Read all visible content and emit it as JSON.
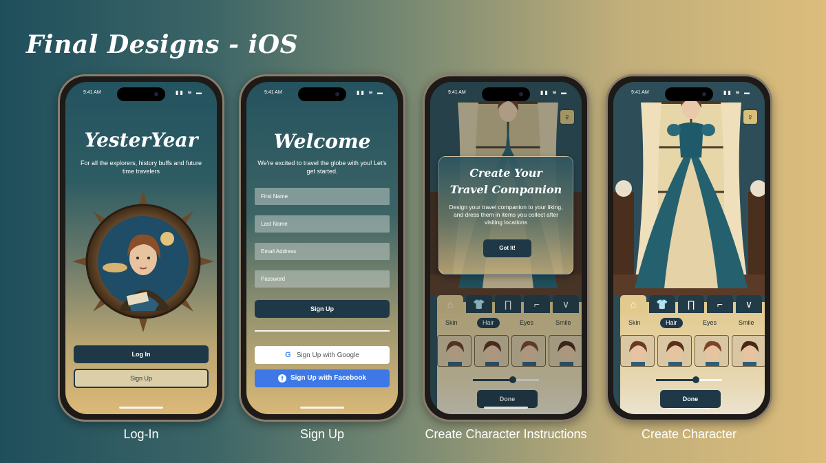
{
  "slide": {
    "title": "Final Designs - iOS"
  },
  "status_bar": {
    "time": "9:41 AM"
  },
  "login": {
    "caption": "Log-In",
    "app_title": "YesterYear",
    "subtitle": "For all the explorers, history buffs and future time travelers",
    "login_button": "Log In",
    "signup_button": "Sign Up"
  },
  "signup": {
    "caption": "Sign Up",
    "title": "Welcome",
    "subtitle": "We're excited to travel the globe with you! Let's get started.",
    "fields": [
      {
        "placeholder": "First Name"
      },
      {
        "placeholder": "Last Name"
      },
      {
        "placeholder": "Email Address"
      },
      {
        "placeholder": "Password"
      }
    ],
    "signup_button": "Sign Up",
    "google_button": "Sign Up with Google",
    "facebook_button": "Sign Up with Facebook"
  },
  "instructions": {
    "caption": "Create Character Instructions",
    "modal_title_line1": "Create Your",
    "modal_title_line2": "Travel Companion",
    "modal_text": "Design your travel companion to your liking, and dress them in items you collect after visiting locations",
    "got_it_button": "Got It!"
  },
  "character": {
    "caption": "Create Character",
    "subtabs": [
      "Skin",
      "Hair",
      "Eyes",
      "Smile"
    ],
    "active_subtab": "Hair",
    "tabs": [
      "hair-icon",
      "shirt-icon",
      "pants-icon",
      "shoe-icon",
      "necklace-icon"
    ],
    "slider_value": 0.6,
    "done_button": "Done"
  },
  "colors": {
    "accent_dark": "#1f3847",
    "gold": "#dcbd7c",
    "teal": "#1f4f5c",
    "facebook": "#3d78e6"
  }
}
